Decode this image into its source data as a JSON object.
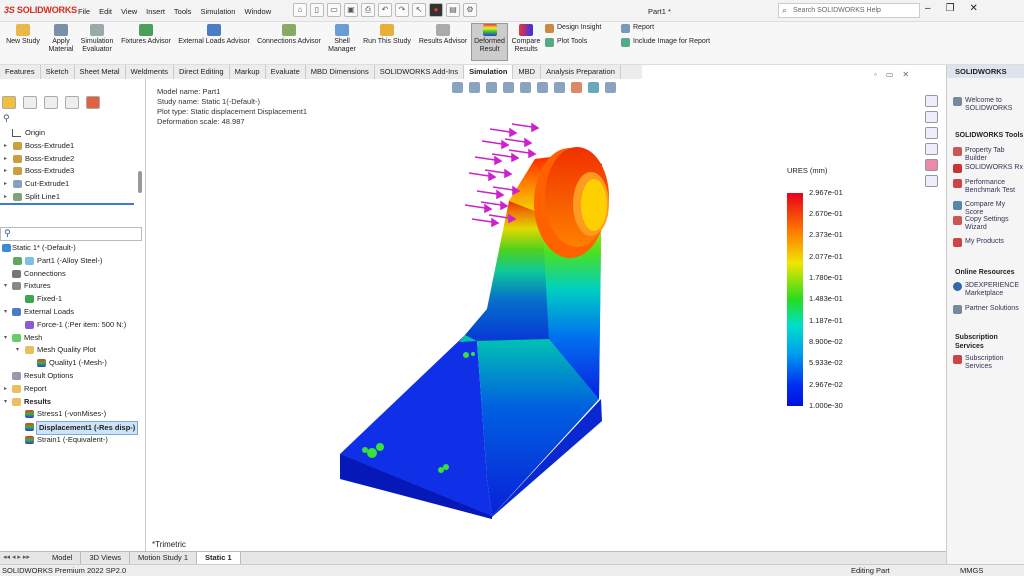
{
  "app": {
    "logo": "SOLIDWORKS",
    "document": "Part1 *",
    "help_placeholder": "Search SOLIDWORKS Help"
  },
  "menu": [
    "File",
    "Edit",
    "View",
    "Insert",
    "Tools",
    "Simulation",
    "Window"
  ],
  "ribbon": {
    "new_study": "New Study",
    "apply_material": "Apply Material",
    "simulation_evaluator": "Simulation Evaluator",
    "fixtures_advisor": "Fixtures Advisor",
    "external_loads_advisor": "External Loads Advisor",
    "connections_advisor": "Connections Advisor",
    "shell_manager": "Shell Manager",
    "run_study": "Run This Study",
    "results_advisor": "Results Advisor",
    "deformed_result": "Deformed Result",
    "compare_results": "Compare Results",
    "design_insight": "Design Insight",
    "plot_tools": "Plot Tools",
    "report": "Report",
    "include_image": "Include Image for Report"
  },
  "tabs": [
    "Features",
    "Sketch",
    "Sheet Metal",
    "Weldments",
    "Direct Editing",
    "Markup",
    "Evaluate",
    "MBD Dimensions",
    "SOLIDWORKS Add-Ins",
    "Simulation",
    "MBD",
    "Analysis Preparation"
  ],
  "feature_tree": [
    "Origin",
    "Boss-Extrude1",
    "Boss-Extrude2",
    "Boss-Extrude3",
    "Cut-Extrude1",
    "Split Line1"
  ],
  "sim_tree": [
    "Static 1* (-Default-)",
    "Part1 (-Alloy Steel-)",
    "Connections",
    "Fixtures",
    "Fixed-1",
    "External Loads",
    "Force-1 (:Per item: 500 N:)",
    "Mesh",
    "Mesh Quality Plot",
    "Quality1 (-Mesh-)",
    "Result Options",
    "Report",
    "Results",
    "Stress1 (-vonMises-)",
    "Displacement1 (-Res disp-)",
    "Strain1 (-Equivalent-)"
  ],
  "plot_info": {
    "model": "Model name: Part1",
    "study": "Study name: Static 1(-Default-)",
    "plot_type": "Plot type: Static displacement Displacement1",
    "scale": "Deformation scale: 48.987"
  },
  "legend": {
    "title": "URES (mm)",
    "ticks": [
      "2.967e-01",
      "2.670e-01",
      "2.373e-01",
      "2.077e-01",
      "1.780e-01",
      "1.483e-01",
      "1.187e-01",
      "8.900e-02",
      "5.933e-02",
      "2.967e-02",
      "1.000e-30"
    ],
    "colors": [
      "#e8001c",
      "#ff7a00",
      "#f0e600",
      "#27dc1f",
      "#00e0c8",
      "#00a0f0",
      "#0010e0"
    ]
  },
  "view_orientation": "*Trimetric",
  "bottom_tabs": [
    "Model",
    "3D Views",
    "Motion Study 1",
    "Static 1"
  ],
  "status": {
    "product": "SOLIDWORKS Premium 2022 SP2.0",
    "mode": "Editing Part",
    "units": "MMGS"
  },
  "task_pane": {
    "header": "SOLIDWORKS",
    "welcome": "Welcome to SOLIDWORKS",
    "tools_title": "SOLIDWORKS Tools",
    "tools": [
      "Property Tab Builder",
      "SOLIDWORKS Rx",
      "Performance Benchmark Test",
      "Compare My Score",
      "Copy Settings Wizard",
      "My Products"
    ],
    "online_title": "Online Resources",
    "online": [
      "3DEXPERIENCE Marketplace",
      "Partner Solutions"
    ],
    "subscription_title": "Subscription Services",
    "subscription": [
      "Subscription Services"
    ]
  }
}
